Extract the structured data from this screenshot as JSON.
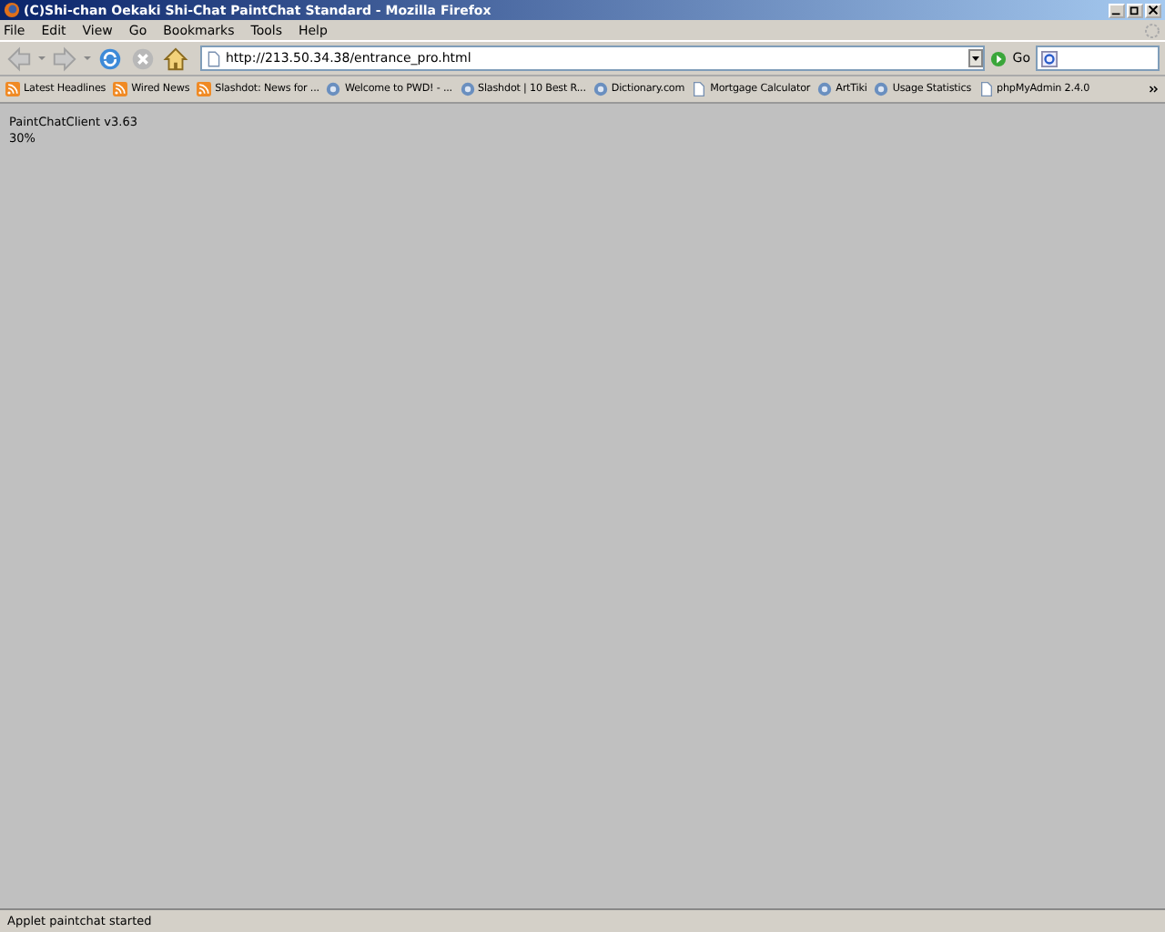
{
  "window": {
    "title": "(C)Shi-chan Oekaki Shi-Chat PaintChat Standard - Mozilla Firefox"
  },
  "menu": [
    "File",
    "Edit",
    "View",
    "Go",
    "Bookmarks",
    "Tools",
    "Help"
  ],
  "address": {
    "value": "http://213.50.34.38/entrance_pro.html"
  },
  "go_button": "Go",
  "bookmarks": [
    {
      "label": "Latest Headlines",
      "kind": "feed"
    },
    {
      "label": "Wired News",
      "kind": "feed"
    },
    {
      "label": "Slashdot: News for ...",
      "kind": "feed"
    },
    {
      "label": "Welcome to PWD! - ...",
      "kind": "site"
    },
    {
      "label": "Slashdot | 10 Best R...",
      "kind": "site"
    },
    {
      "label": "Dictionary.com",
      "kind": "site"
    },
    {
      "label": "Mortgage Calculator",
      "kind": "page"
    },
    {
      "label": "ArtTiki",
      "kind": "site"
    },
    {
      "label": "Usage Statistics",
      "kind": "site"
    },
    {
      "label": "phpMyAdmin 2.4.0",
      "kind": "page"
    }
  ],
  "content": {
    "lines": [
      "PaintChatClient v3.63",
      "30%"
    ]
  },
  "status_bar": "Applet paintchat started"
}
